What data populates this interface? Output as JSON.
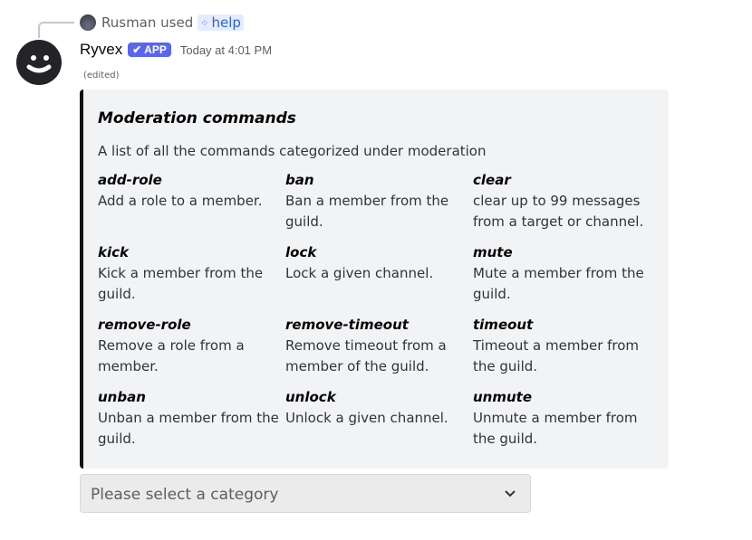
{
  "reply": {
    "user": "Rusman",
    "used": "used",
    "command": "help",
    "command_icon": "slash-command-icon"
  },
  "message": {
    "author": "Ryvex",
    "badge": "✔ APP",
    "timestamp": "Today at 4:01 PM",
    "edited": "(edited)"
  },
  "embed": {
    "accent_color": "#111111",
    "title": "Moderation commands",
    "description": "A list of all the commands categorized under moderation",
    "fields": [
      {
        "name": "add-role",
        "value": "Add a role to a member."
      },
      {
        "name": "ban",
        "value": "Ban a member from the guild."
      },
      {
        "name": "clear",
        "value": "clear up to 99 messages from a target or channel."
      },
      {
        "name": "kick",
        "value": "Kick a member from the guild."
      },
      {
        "name": "lock",
        "value": "Lock a given channel."
      },
      {
        "name": "mute",
        "value": "Mute a member from the guild."
      },
      {
        "name": "remove-role",
        "value": "Remove a role from a member."
      },
      {
        "name": "remove-timeout",
        "value": "Remove timeout from a member of the guild."
      },
      {
        "name": "timeout",
        "value": "Timeout a member from the guild."
      },
      {
        "name": "unban",
        "value": "Unban a member from the guild."
      },
      {
        "name": "unlock",
        "value": "Unlock a given channel."
      },
      {
        "name": "unmute",
        "value": "Unmute a member from the guild."
      }
    ]
  },
  "select": {
    "placeholder": "Please select a category"
  }
}
